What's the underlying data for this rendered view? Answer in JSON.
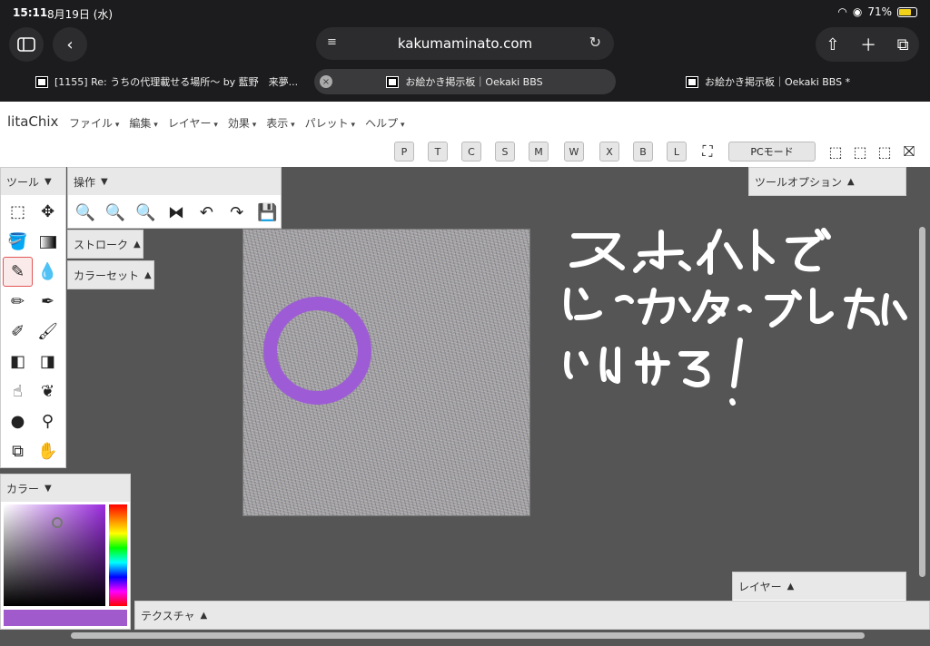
{
  "status": {
    "time": "15:11",
    "date": "8月19日 (水)",
    "battery": "71%"
  },
  "browser": {
    "url": "kakumaminato.com",
    "tabs": [
      {
        "title": "[1155] Re: うちの代理載せる場所〜 by 藍野　来夢..."
      },
      {
        "title": "お絵かき掲示板｜Oekaki BBS"
      },
      {
        "title": "お絵かき掲示板｜Oekaki BBS *"
      }
    ]
  },
  "app": {
    "logo": "litaChix",
    "menus": [
      "ファイル",
      "編集",
      "レイヤー",
      "効果",
      "表示",
      "パレット",
      "ヘルプ"
    ],
    "shortcut_buttons": [
      "P",
      "T",
      "C",
      "S",
      "M",
      "W",
      "X",
      "B",
      "L"
    ],
    "pc_mode": "PCモード",
    "panels": {
      "tools": "ツール",
      "operations": "操作",
      "stroke": "ストローク",
      "colorset": "カラーセット",
      "tool_options": "ツールオプション",
      "color": "カラー",
      "texture": "テクスチャ",
      "layer": "レイヤー"
    },
    "current_color": "#a05acb",
    "ring_color": "#9d5cd6",
    "handwritten_lines": [
      "スポイトで",
      "どっかタップしたら",
      "いけるよ！"
    ]
  }
}
